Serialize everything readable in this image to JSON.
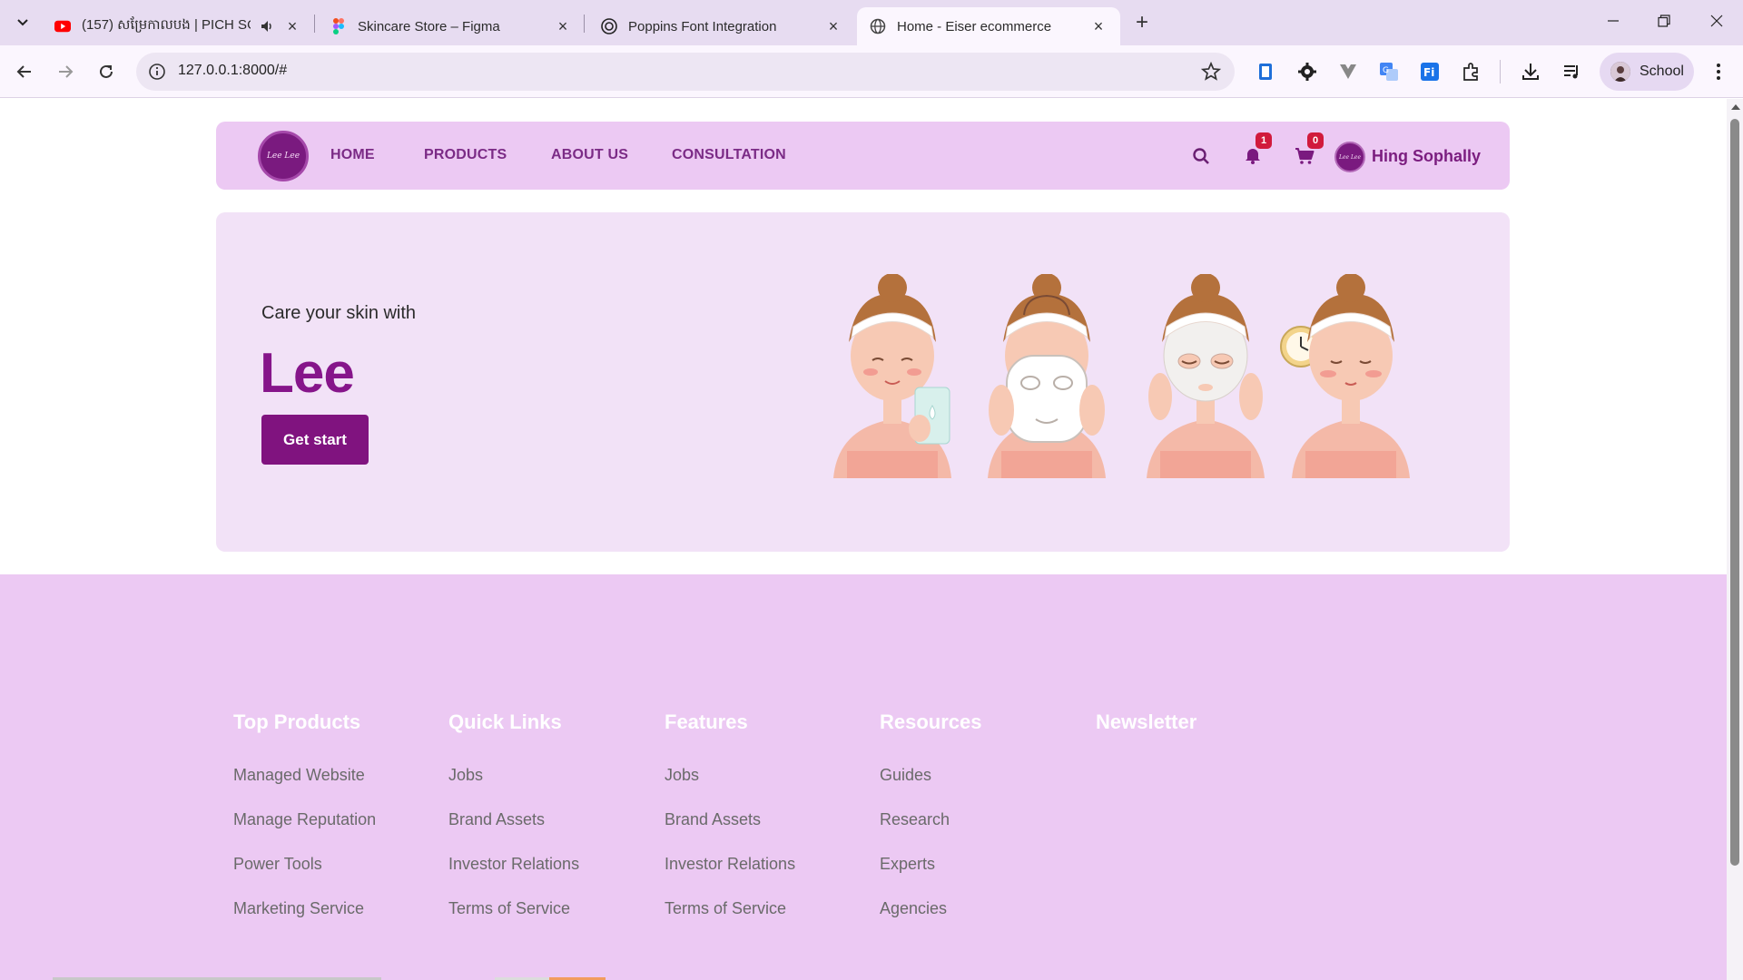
{
  "browser": {
    "tabs": [
      {
        "title": "(157) សម្រែកាលបង | PICH SO",
        "icon": "youtube-icon",
        "muted_icon": "speaker-icon"
      },
      {
        "title": "Skincare Store – Figma",
        "icon": "figma-icon"
      },
      {
        "title": "Poppins Font Integration",
        "icon": "openai-icon"
      },
      {
        "title": "Home - Eiser ecommerce",
        "icon": "globe-icon",
        "active": true
      }
    ],
    "url": "127.0.0.1:8000/#",
    "profile_label": "School"
  },
  "site": {
    "logo_text": "Lee Lee",
    "nav": {
      "items": [
        "HOME",
        "PRODUCTS",
        "ABOUT US",
        "CONSULTATION"
      ]
    },
    "notifications_count": "1",
    "cart_count": "0",
    "avatar_text": "Lee Lee",
    "user_name": "Hing Sophally"
  },
  "hero": {
    "subtitle": "Care your skin with",
    "title": "Lee",
    "button_label": "Get start"
  },
  "footer": {
    "columns": [
      {
        "heading": "Top Products",
        "links": [
          "Managed Website",
          "Manage Reputation",
          "Power Tools",
          "Marketing Service"
        ]
      },
      {
        "heading": "Quick Links",
        "links": [
          "Jobs",
          "Brand Assets",
          "Investor Relations",
          "Terms of Service"
        ]
      },
      {
        "heading": "Features",
        "links": [
          "Jobs",
          "Brand Assets",
          "Investor Relations",
          "Terms of Service"
        ]
      },
      {
        "heading": "Resources",
        "links": [
          "Guides",
          "Research",
          "Experts",
          "Agencies"
        ]
      },
      {
        "heading": "Newsletter",
        "links": []
      }
    ]
  },
  "colors": {
    "brand": "#86158a",
    "nav_bg": "#ecc9f3",
    "hero_bg": "#f2e2f7",
    "footer_bg": "#ecc9f3",
    "badge": "#d11a3c"
  }
}
